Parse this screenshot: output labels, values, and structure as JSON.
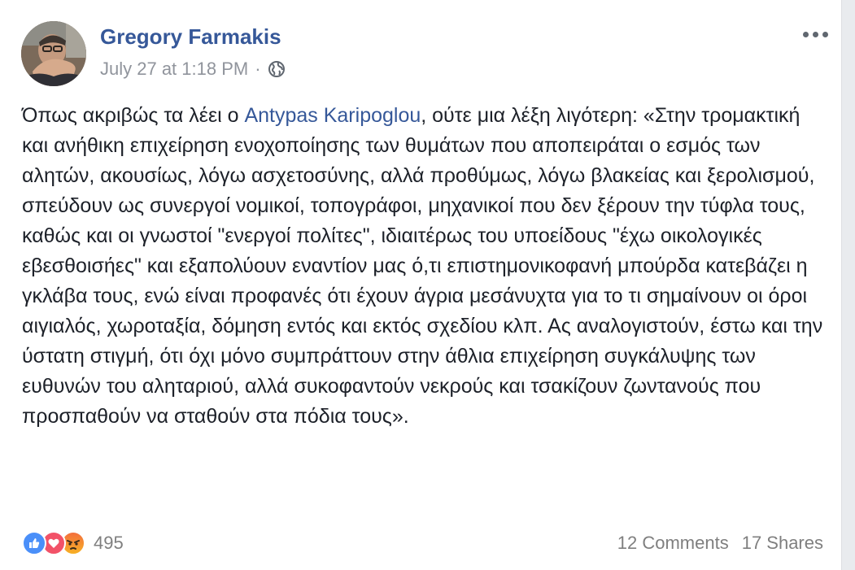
{
  "post": {
    "author": "Gregory Farmakis",
    "timestamp": "July 27 at 1:18 PM",
    "separator": "·",
    "privacy_icon": "globe-icon",
    "text_before_mention": "Όπως ακριβώς τα λέει ο ",
    "mention": "Antypas Karipoglou",
    "text_after_mention": ", ούτε μια λέξη λιγότερη: «Στην τρομακτική και ανήθικη επιχείρηση ενοχοποίησης των θυμάτων που αποπειράται ο εσμός των αλητών, ακουσίως, λόγω ασχετοσύνης, αλλά προθύμως, λόγω βλακείας και ξερολισμού, σπεύδουν ως συνεργοί νομικοί, τοπογράφοι, μηχανικοί που δεν ξέρουν την τύφλα τους, καθώς και οι γνωστοί \"ενεργοί πολίτες\", ιδιαιτέρως του υποείδους \"έχω οικολογικές εβεσθοισήες\" και εξαπολύουν εναντίον μας ό,τι επιστημονικοφανή μπούρδα κατεβάζει η γκλάβα τους, ενώ είναι προφανές ότι έχουν άγρια μεσάνυχτα για το τι σημαίνουν οι όροι αιγιαλός, χωροταξία, δόμηση εντός και εκτός σχεδίου κλπ. Ας αναλογιστούν, έστω και την ύστατη στιγμή, ότι όχι μόνο συμπράττουν στην άθλια επιχείρηση συγκάλυψης των ευθυνών του αληταριού, αλλά συκοφαντούν νεκρούς και τσακίζουν ζωντανούς που προσπαθούν να σταθούν στα πόδια τους»."
  },
  "footer": {
    "reaction_icons": [
      "like-icon",
      "love-icon",
      "angry-icon"
    ],
    "reaction_count": "495",
    "comments": "12 Comments",
    "shares": "17 Shares"
  },
  "colors": {
    "link": "#365899",
    "meta": "#90949c",
    "text": "#1d2129",
    "like": "#4a8ff9",
    "love": "#f25268",
    "angry": "#f7b125"
  }
}
